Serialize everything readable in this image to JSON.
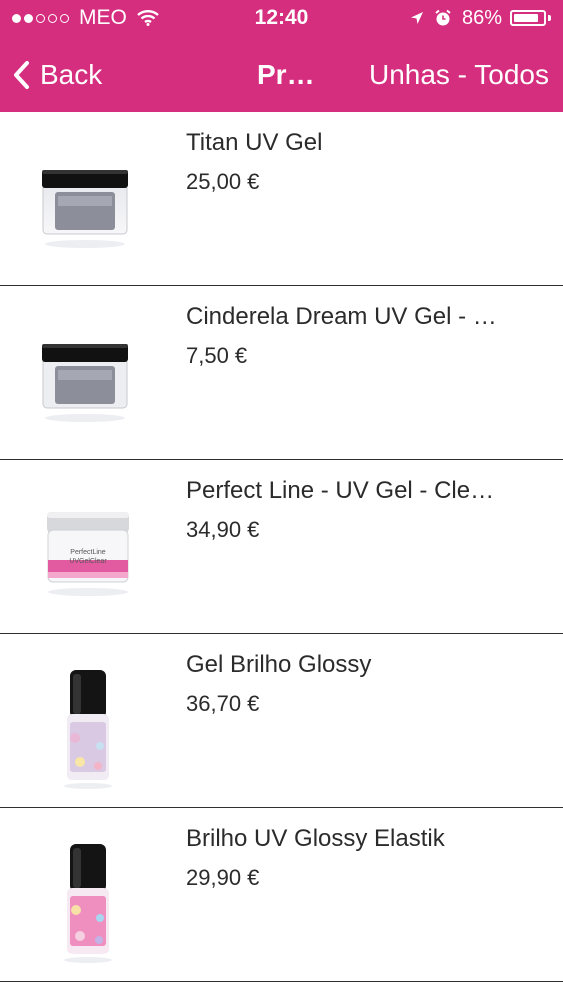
{
  "status_bar": {
    "carrier": "MEO",
    "time": "12:40",
    "battery": "86%",
    "battery_level": 0.86,
    "signal_bars_filled": 2,
    "signal_bars_total": 5
  },
  "nav": {
    "back_label": "Back",
    "title": "Pr…",
    "right_label": "Unhas - Todos"
  },
  "theme": {
    "accent": "#d52e7f",
    "text": "#2b2b2b",
    "divider": "#2f2f2f"
  },
  "products": [
    {
      "name": "Titan UV Gel",
      "price": "25,00 €",
      "icon": "gel-jar-icon"
    },
    {
      "name": "Cinderela Dream UV Gel - …",
      "price": "7,50 €",
      "icon": "gel-jar-icon"
    },
    {
      "name": "Perfect Line - UV Gel - Cle…",
      "price": "34,90 €",
      "icon": "gel-jar-clear-icon",
      "thumb_text": [
        "PerfectLine",
        "UVGelClear"
      ]
    },
    {
      "name": "Gel Brilho Glossy",
      "price": "36,70 €",
      "icon": "polish-bottle-icon"
    },
    {
      "name": "Brilho UV Glossy Elastik",
      "price": "29,90 €",
      "icon": "polish-bottle-icon"
    }
  ]
}
